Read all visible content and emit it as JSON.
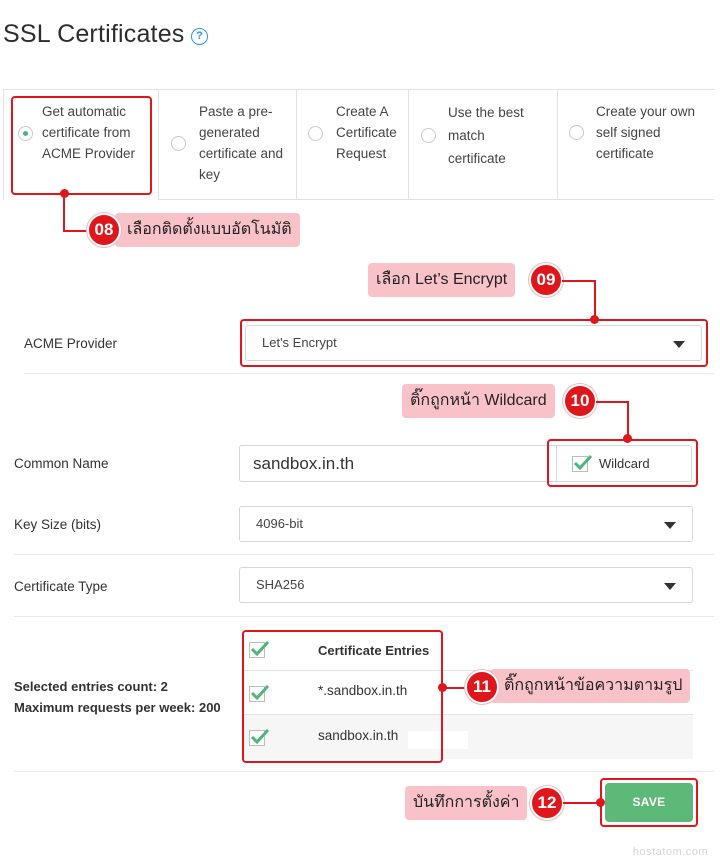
{
  "page": {
    "title": "SSL Certificates",
    "help_icon": "question-circle-icon"
  },
  "methods": [
    {
      "label": "Get automatic\ncertificate from\nACME Provider",
      "selected": true
    },
    {
      "label": "Paste a pre-\ngenerated\ncertificate and\nkey",
      "selected": false
    },
    {
      "label": "Create A\nCertificate\nRequest",
      "selected": false
    },
    {
      "label": "Use the best\nmatch\ncertificate",
      "selected": false
    },
    {
      "label": "Create your own\nself signed\ncertificate",
      "selected": false
    }
  ],
  "form": {
    "acme_provider": {
      "label": "ACME Provider",
      "value": "Let's Encrypt"
    },
    "common_name": {
      "label": "Common Name",
      "value": "sandbox.in.th",
      "wildcard_label": "Wildcard",
      "wildcard_checked": true
    },
    "key_size": {
      "label": "Key Size (bits)",
      "value": "4096-bit"
    },
    "certificate_type": {
      "label": "Certificate Type",
      "value": "SHA256"
    },
    "entries": {
      "selected_count": "Selected entries count: 2",
      "max_requests": "Maximum requests per week: 200",
      "header": "Certificate Entries",
      "rows": [
        "*.sandbox.in.th",
        "sandbox.in.th"
      ]
    },
    "save_label": "SAVE"
  },
  "annotations": [
    {
      "number": "08",
      "text": "เลือกติดตั้งแบบอัตโนมัติ"
    },
    {
      "number": "09",
      "text": "เลือก Let’s Encrypt"
    },
    {
      "number": "10",
      "text": "ติ๊กถูกหน้า Wildcard"
    },
    {
      "number": "11",
      "text": "ติ๊กถูกหน้าข้อความตามรูป"
    },
    {
      "number": "12",
      "text": "บันทึกการตั้งค่า"
    }
  ],
  "colors": {
    "accent_red": "#e0161d",
    "note_pink": "#f9c2c8",
    "save_green": "#5cb978",
    "check_green": "#4fb57a",
    "help_blue": "#2a97d6"
  },
  "watermark": "hostatom.com"
}
